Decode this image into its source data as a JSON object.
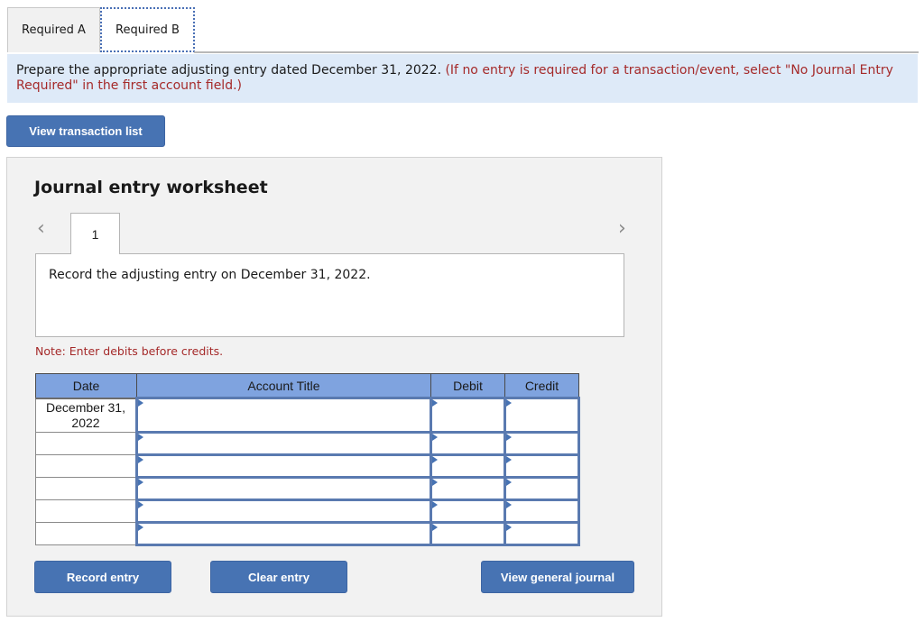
{
  "tabs": [
    {
      "label": "Required A",
      "active": false
    },
    {
      "label": "Required B",
      "active": true
    }
  ],
  "instructions": {
    "main": "Prepare the appropriate adjusting entry dated December 31, 2022. ",
    "note": "(If no entry is required for a transaction/event, select \"No Journal Entry Required\" in the first account field.)"
  },
  "view_transaction_list_label": "View transaction list",
  "worksheet": {
    "title": "Journal entry worksheet",
    "prev_icon": "chevron-left-icon",
    "next_icon": "chevron-right-icon",
    "entry_number": "1",
    "entry_description": "Record the adjusting entry on December 31, 2022.",
    "note": "Note: Enter debits before credits.",
    "table": {
      "headers": {
        "date": "Date",
        "account": "Account Title",
        "debit": "Debit",
        "credit": "Credit"
      },
      "rows": [
        {
          "date": "December 31, 2022",
          "account": "",
          "debit": "",
          "credit": ""
        },
        {
          "date": "",
          "account": "",
          "debit": "",
          "credit": ""
        },
        {
          "date": "",
          "account": "",
          "debit": "",
          "credit": ""
        },
        {
          "date": "",
          "account": "",
          "debit": "",
          "credit": ""
        },
        {
          "date": "",
          "account": "",
          "debit": "",
          "credit": ""
        },
        {
          "date": "",
          "account": "",
          "debit": "",
          "credit": ""
        }
      ]
    },
    "buttons": {
      "record": "Record entry",
      "clear": "Clear entry",
      "view_journal": "View general journal"
    }
  },
  "colors": {
    "accent": "#4773b3",
    "header": "#7fa3df",
    "note_red": "#a52a2a",
    "banner": "#deeaf8"
  }
}
